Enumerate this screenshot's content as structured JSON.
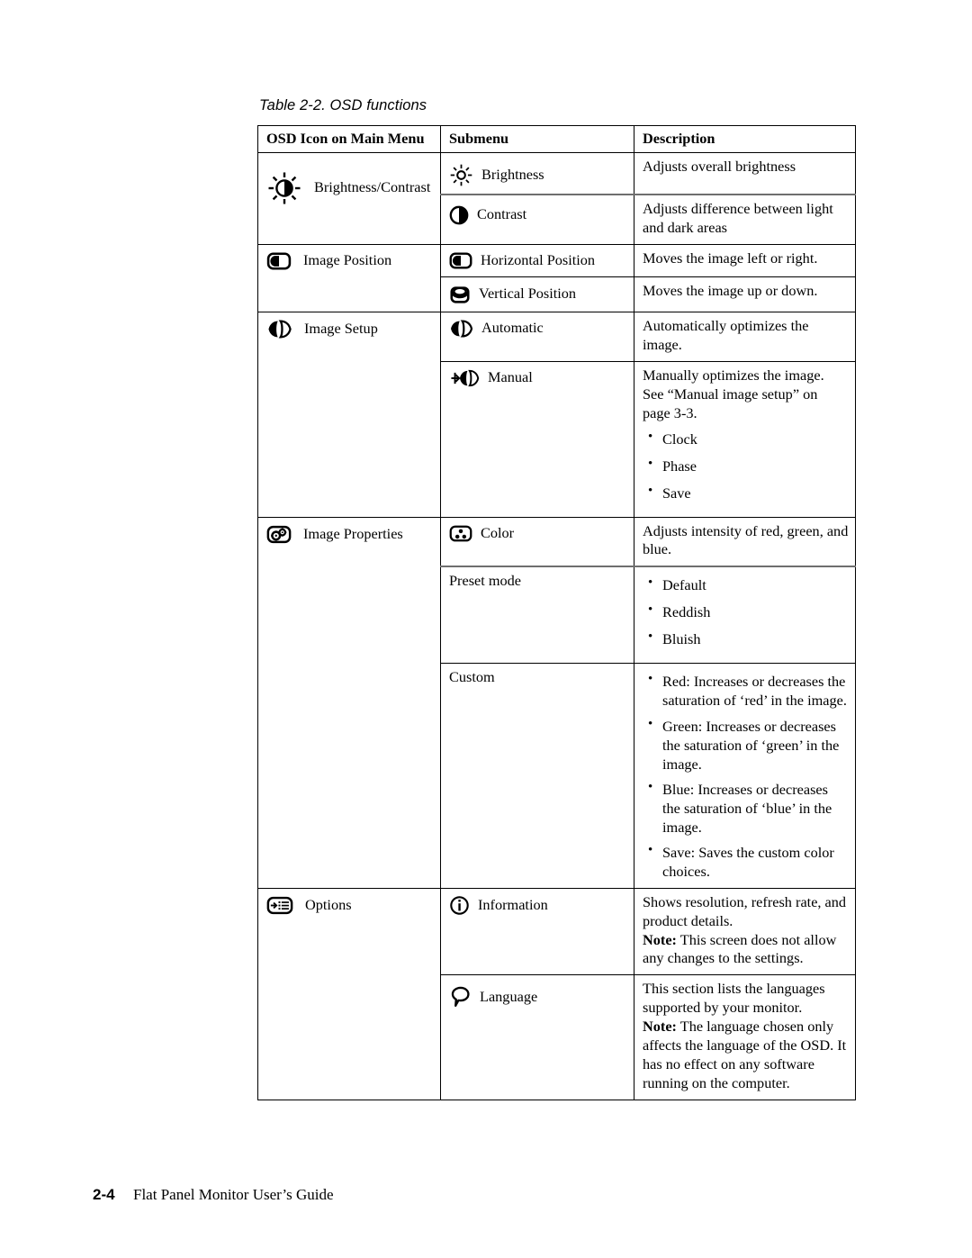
{
  "caption": "Table 2-2. OSD functions",
  "table": {
    "headers": {
      "col1": "OSD Icon on Main Menu",
      "col2": "Submenu",
      "col3": "Description"
    },
    "rows": [
      {
        "main_icon": "brightness-contrast-icon",
        "main_label": "Brightness/Contrast",
        "sub_icon": "brightness-sun-icon",
        "sub_label": "Brightness",
        "desc": "Adjusts overall brightness"
      },
      {
        "sub_icon": "contrast-half-circle-icon",
        "sub_label": "Contrast",
        "desc": "Adjusts difference between light and dark areas"
      },
      {
        "main_icon": "image-position-icon",
        "main_label": "Image Position",
        "sub_icon": "horizontal-position-icon",
        "sub_label": "Horizontal Position",
        "desc": "Moves the image left or right."
      },
      {
        "sub_icon": "vertical-position-icon",
        "sub_label": "Vertical Position",
        "desc": "Moves the image up or down."
      },
      {
        "main_icon": "image-setup-icon",
        "main_label": "Image Setup",
        "sub_icon": "automatic-icon",
        "sub_label": "Automatic",
        "desc": "Automatically optimizes the image."
      },
      {
        "sub_icon": "manual-icon",
        "sub_label": "Manual",
        "desc": "Manually optimizes the image. See “Manual image setup” on page 3-3.",
        "bullets": [
          "Clock",
          "Phase",
          "Save"
        ]
      },
      {
        "main_icon": "image-properties-icon",
        "main_label": "Image Properties",
        "sub_icon": "color-icon",
        "sub_label": "Color",
        "desc": "Adjusts intensity of red, green, and blue."
      },
      {
        "sub_label": "Preset mode",
        "bullets": [
          "Default",
          "Reddish",
          "Bluish"
        ]
      },
      {
        "sub_label": "Custom",
        "bullets": [
          "Red: Increases or decreases the saturation of ‘red’ in the image.",
          "Green: Increases or decreases the saturation of ‘green’ in the image.",
          "Blue: Increases or decreases the saturation of ‘blue’ in the image.",
          "Save: Saves the custom color choices."
        ]
      },
      {
        "main_icon": "options-icon",
        "main_label": "Options",
        "sub_icon": "information-icon",
        "sub_label": "Information",
        "desc": "Shows resolution, refresh rate, and product details.",
        "note_label": "Note:",
        "note_text": " This screen does not allow any changes to the settings."
      },
      {
        "sub_icon": "language-icon",
        "sub_label": "Language",
        "desc": "This section lists the languages supported by your monitor.",
        "note_label": "Note:",
        "note_text": " The language chosen only affects the language of the OSD. It has no effect on any software running on the computer."
      }
    ]
  },
  "footer": {
    "page_number": "2-4",
    "title": "Flat Panel Monitor User’s Guide"
  }
}
